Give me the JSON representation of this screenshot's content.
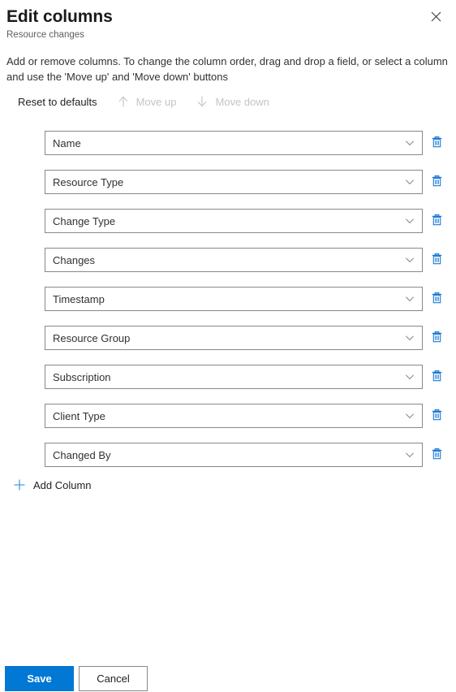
{
  "header": {
    "title": "Edit columns",
    "subtitle": "Resource changes",
    "close_label": "Close"
  },
  "description": "Add or remove columns. To change the column order, drag and drop a field, or select a column and use the 'Move up' and 'Move down' buttons",
  "commandbar": {
    "reset_label": "Reset to defaults",
    "move_up_label": "Move up",
    "move_down_label": "Move down"
  },
  "columns": [
    {
      "label": "Name"
    },
    {
      "label": "Resource Type"
    },
    {
      "label": "Change Type"
    },
    {
      "label": "Changes"
    },
    {
      "label": "Timestamp"
    },
    {
      "label": "Resource Group"
    },
    {
      "label": "Subscription"
    },
    {
      "label": "Client Type"
    },
    {
      "label": "Changed By"
    }
  ],
  "add_column": {
    "label": "Add Column"
  },
  "footer": {
    "save_label": "Save",
    "cancel_label": "Cancel"
  },
  "colors": {
    "accent": "#0078d4",
    "text": "#323130",
    "title": "#1b1a19",
    "subtitle": "#605e5c",
    "disabled": "#c6c4c2",
    "border": "#8a8886"
  }
}
